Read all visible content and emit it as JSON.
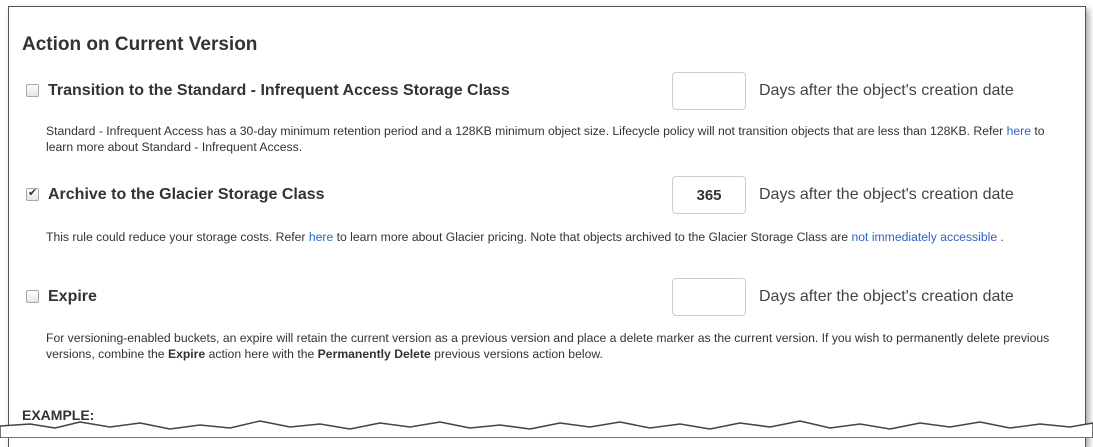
{
  "section_title": "Action on Current Version",
  "transition": {
    "label": "Transition to the Standard - Infrequent Access Storage Class",
    "checked": false,
    "days_value": "",
    "days_suffix": "Days after the object's creation date",
    "desc_text_1": "Standard - Infrequent Access has a 30-day minimum retention period and a 128KB minimum object size. Lifecycle policy will not transition objects that are less than 128KB. Refer ",
    "desc_link": "here",
    "desc_text_2": " to learn more about Standard - Infrequent Access."
  },
  "glacier": {
    "label": "Archive to the Glacier Storage Class",
    "checked": true,
    "days_value": "365",
    "days_suffix": "Days after the object's creation date",
    "desc_text_1": "This rule could reduce your storage costs. Refer ",
    "desc_link": "here",
    "desc_text_2": " to learn more about Glacier pricing. Note that objects archived to the Glacier Storage Class are ",
    "desc_link_2": "not immediately accessible",
    "desc_text_3": " ."
  },
  "expire": {
    "label": "Expire",
    "checked": false,
    "days_value": "",
    "days_suffix": "Days after the object's creation date",
    "desc_text_1": "For versioning-enabled buckets, an expire will retain the current version as a previous version and place a delete marker as the current version. If you wish to permanently delete previous versions, combine the ",
    "desc_bold_1": "Expire",
    "desc_text_2": " action here with the ",
    "desc_bold_2": "Permanently Delete",
    "desc_text_3": " previous versions action below."
  },
  "example_label": "EXAMPLE:",
  "colors": {
    "link": "#2a64c5",
    "text": "#333333",
    "input_border": "#cccccc"
  }
}
